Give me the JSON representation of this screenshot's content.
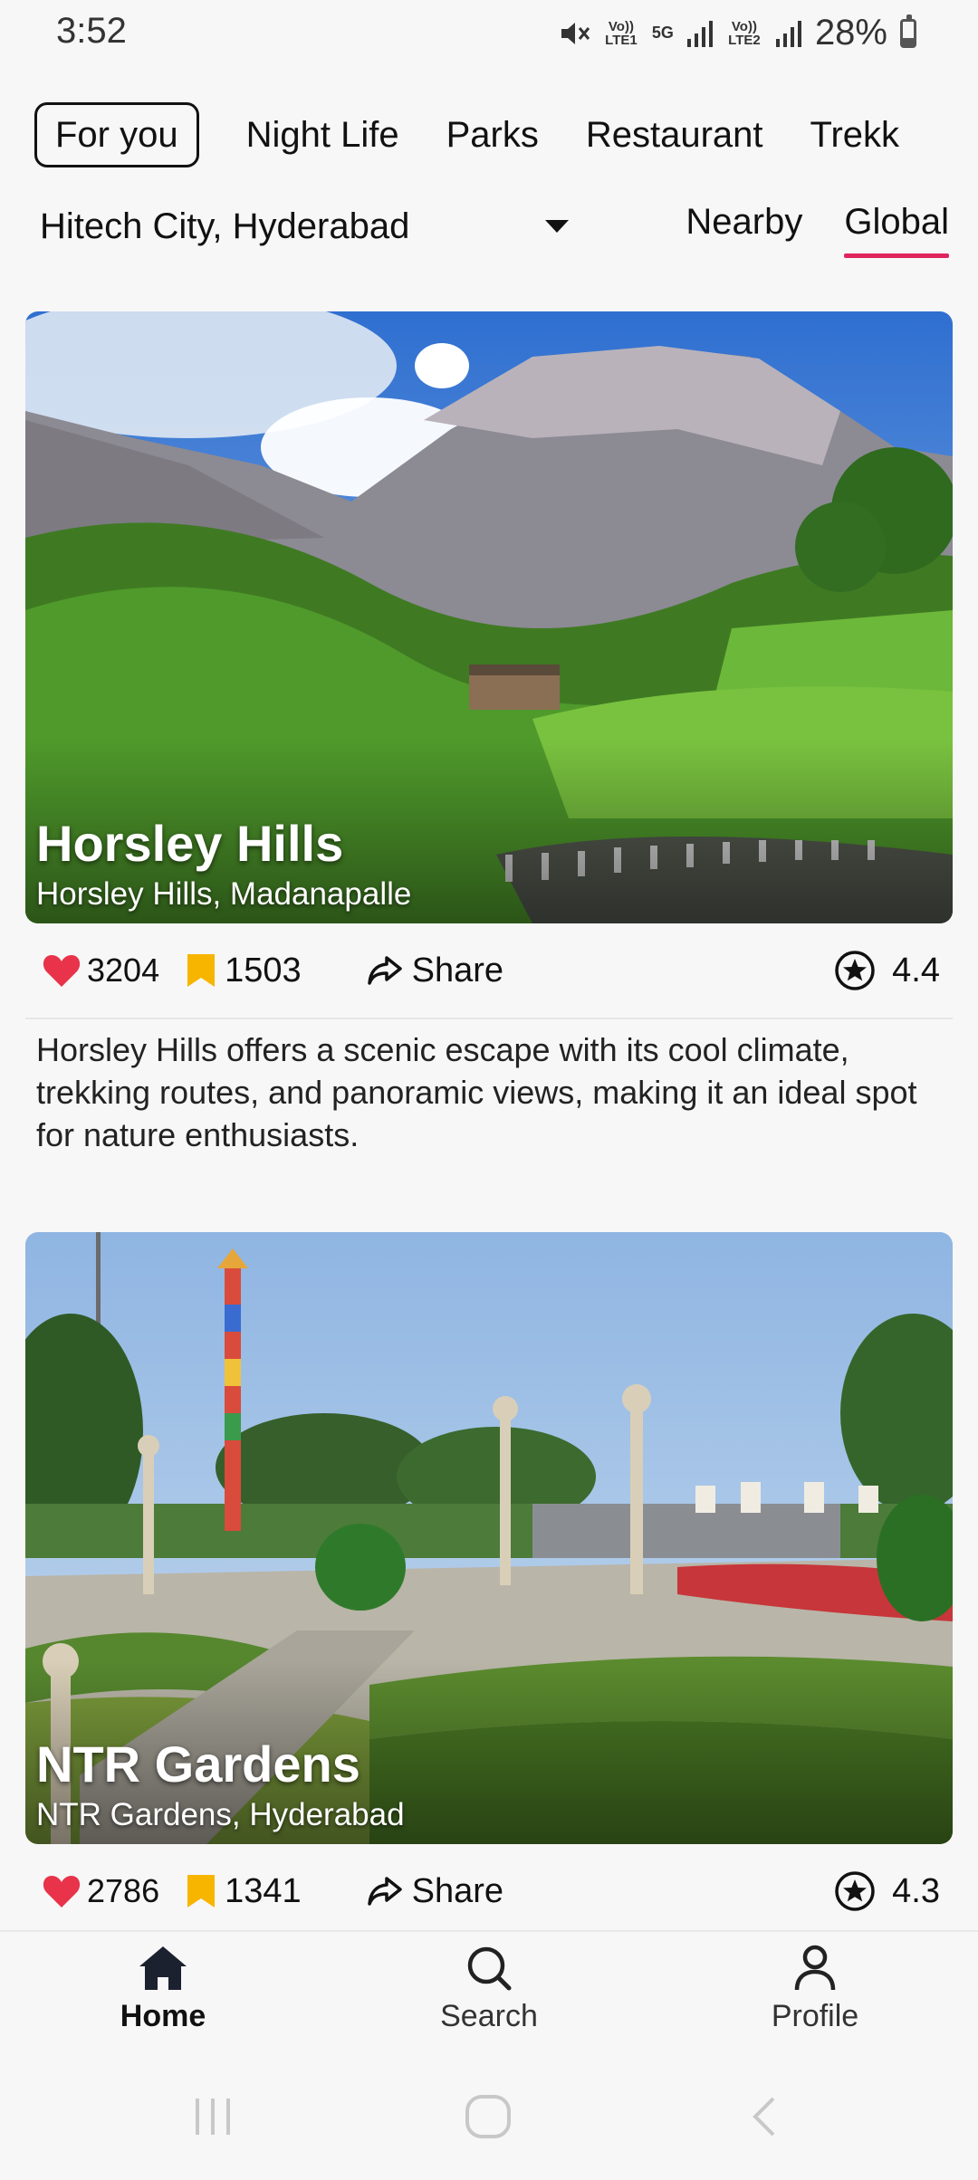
{
  "status_bar": {
    "time": "3:52",
    "battery": "28%",
    "battery_level": 0.28,
    "icons": [
      "mute-icon",
      "volte-lte1-icon",
      "5g-icon",
      "signal-icon",
      "volte-lte2-icon",
      "signal-icon",
      "battery-icon"
    ],
    "net_tags": {
      "lte1": "Vo)) LTE1",
      "fiveg": "5G",
      "lte2": "Vo)) LTE2"
    }
  },
  "categories": {
    "items": [
      "For you",
      "Night Life",
      "Parks",
      "Restaurant",
      "Trekk"
    ],
    "active": "For you"
  },
  "location": {
    "selected": "Hitech City, Hyderabad"
  },
  "scope": {
    "items": [
      "Nearby",
      "Global"
    ],
    "active": "Global"
  },
  "cards": [
    {
      "title": "Horsley Hills",
      "subtitle": "Horsley Hills, Madanapalle",
      "likes": "3204",
      "saves": "1503",
      "share_label": "Share",
      "rating": "4.4",
      "description": "Horsley Hills offers a scenic escape with its cool climate, trekking routes, and panoramic views, making it an ideal spot for nature enthusiasts."
    },
    {
      "title": "NTR Gardens",
      "subtitle": "NTR Gardens, Hyderabad",
      "likes": "2786",
      "saves": "1341",
      "share_label": "Share",
      "rating": "4.3"
    }
  ],
  "bottom_nav": {
    "items": [
      "Home",
      "Search",
      "Profile"
    ],
    "active": "Home"
  },
  "colors": {
    "accent": "#e0245e",
    "heart": "#e8334a",
    "bookmark": "#f7b500"
  }
}
